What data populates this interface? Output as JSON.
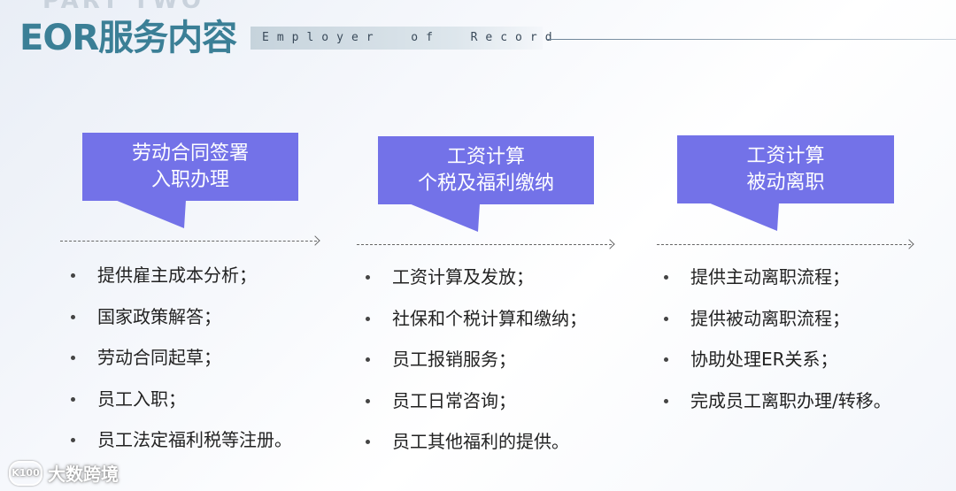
{
  "header": {
    "part_label": "PART TWO",
    "title": "EOR服务内容",
    "subtitle": "Employer  of  Record"
  },
  "columns": [
    {
      "heading_lines": [
        "劳动合同签署",
        "入职办理"
      ],
      "items": [
        "提供雇主成本分析；",
        "国家政策解答；",
        "劳动合同起草；",
        "员工入职；",
        "员工法定福利税等注册。"
      ]
    },
    {
      "heading_lines": [
        "工资计算",
        "个税及福利缴纳"
      ],
      "items": [
        "工资计算及发放；",
        "社保和个税计算和缴纳；",
        "员工报销服务；",
        "员工日常咨询；",
        "员工其他福利的提供。"
      ]
    },
    {
      "heading_lines": [
        "工资计算",
        "被动离职"
      ],
      "items": [
        "提供主动离职流程；",
        "提供被动离职流程；",
        "协助处理ER关系；",
        "完成员工离职办理/转移。"
      ]
    }
  ],
  "watermark": {
    "text": "大数跨境",
    "logo": "K100"
  },
  "colors": {
    "bubble": "#7372e8",
    "title": "#3b7f96"
  }
}
